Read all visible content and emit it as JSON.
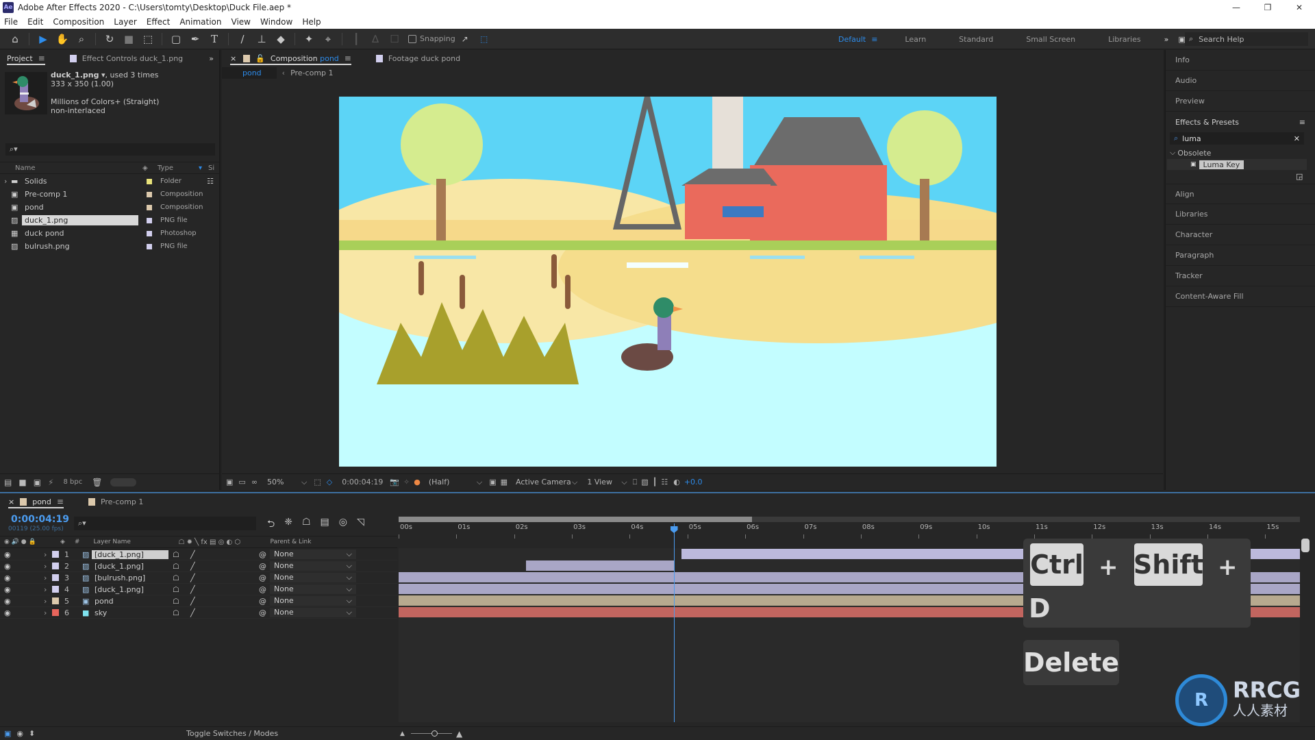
{
  "window": {
    "app_icon": "Ae",
    "title": "Adobe After Effects 2020 - C:\\Users\\tomty\\Desktop\\Duck File.aep *",
    "controls": [
      "minimize",
      "restore",
      "close"
    ]
  },
  "menu": [
    "File",
    "Edit",
    "Composition",
    "Layer",
    "Effect",
    "Animation",
    "View",
    "Window",
    "Help"
  ],
  "toolbar": {
    "tools": [
      "home-icon",
      "selection-tool-icon",
      "hand-tool-icon",
      "zoom-tool-icon",
      "rotate-tool-icon",
      "camera-tool-icon",
      "pan-behind-icon",
      "rectangle-tool-icon",
      "pen-tool-icon",
      "type-tool-icon",
      "brush-tool-icon",
      "clone-stamp-icon",
      "eraser-icon",
      "roto-brush-icon",
      "puppet-pin-icon"
    ],
    "snapping_label": "Snapping",
    "workspaces": [
      "Default",
      "Learn",
      "Standard",
      "Small Screen",
      "Libraries"
    ],
    "active_workspace": "Default",
    "search_help_placeholder": "Search Help"
  },
  "project_panel": {
    "tabs": [
      {
        "label": "Project",
        "active": true
      },
      {
        "label": "Effect Controls duck_1.png",
        "active": false
      }
    ],
    "selected_file": {
      "name": "duck_1.png",
      "used": ", used 3 times",
      "dimensions": "333 x 350 (1.00)",
      "colors": "Millions of Colors+ (Straight)",
      "interlace": "non-interlaced"
    },
    "columns": {
      "name": "Name",
      "type": "Type",
      "size": "Si"
    },
    "items": [
      {
        "name": "Solids",
        "type": "Folder",
        "color": "#e8e27a",
        "icon": "folder-icon",
        "expandable": true
      },
      {
        "name": "Pre-comp 1",
        "type": "Composition",
        "color": "#dcc9ac",
        "icon": "composition-icon"
      },
      {
        "name": "pond",
        "type": "Composition",
        "color": "#dcc9ac",
        "icon": "composition-icon"
      },
      {
        "name": "duck_1.png",
        "type": "PNG file",
        "color": "#d2cfee",
        "icon": "image-file-icon",
        "selected": true
      },
      {
        "name": "duck pond",
        "type": "Photoshop",
        "color": "#d2cfee",
        "icon": "photoshop-file-icon"
      },
      {
        "name": "bulrush.png",
        "type": "PNG file",
        "color": "#d2cfee",
        "icon": "image-file-icon"
      }
    ],
    "bpc_label": "8 bpc"
  },
  "composition_panel": {
    "tabs": [
      {
        "label": "Composition",
        "comp": "pond",
        "active": true
      },
      {
        "label": "Footage duck pond",
        "active": false
      }
    ],
    "breadcrumbs": [
      "pond",
      "Pre-comp 1"
    ],
    "footer": {
      "zoom": "50%",
      "timecode": "0:00:04:19",
      "resolution": "(Half)",
      "camera": "Active Camera",
      "views": "1 View",
      "exposure": "+0.0"
    }
  },
  "right_panels": {
    "items_top": [
      "Info",
      "Audio",
      "Preview"
    ],
    "effects_presets": {
      "title": "Effects & Presets",
      "search_value": "luma",
      "category": "Obsolete",
      "result": "Luma Key"
    },
    "items_bottom": [
      "Align",
      "Libraries",
      "Character",
      "Paragraph",
      "Tracker",
      "Content-Aware Fill"
    ]
  },
  "timeline": {
    "tabs": [
      {
        "label": "pond",
        "active": true
      },
      {
        "label": "Pre-comp 1",
        "active": false
      }
    ],
    "timecode": "0:00:04:19",
    "frame_info": "00119 (25.00 fps)",
    "columns": {
      "layer_name": "Layer Name",
      "parent": "Parent & Link",
      "num": "#"
    },
    "ruler": [
      "00s",
      "01s",
      "02s",
      "03s",
      "04s",
      "05s",
      "06s",
      "07s",
      "08s",
      "09s",
      "10s",
      "11s",
      "12s",
      "13s",
      "14s",
      "15s"
    ],
    "playhead_seconds": 4.76,
    "duration_seconds": 15.6,
    "layers": [
      {
        "num": "1",
        "name": "[duck_1.png]",
        "color": "#d2cfee",
        "icon": "image-file-icon",
        "parent": "None",
        "bar_color": "#a9a6c6",
        "in": 4.9,
        "out": 15.6,
        "selected": true
      },
      {
        "num": "2",
        "name": "[duck_1.png]",
        "color": "#d2cfee",
        "icon": "image-file-icon",
        "parent": "None",
        "bar_color": "#a9a6c6",
        "in": 2.2,
        "out": 4.76
      },
      {
        "num": "3",
        "name": "[bulrush.png]",
        "color": "#d2cfee",
        "icon": "image-file-icon",
        "parent": "None",
        "bar_color": "#a9a6c6",
        "in": 0,
        "out": 15.6
      },
      {
        "num": "4",
        "name": "[duck_1.png]",
        "color": "#d2cfee",
        "icon": "image-file-icon",
        "parent": "None",
        "bar_color": "#a9a6c6",
        "in": 0,
        "out": 15.6
      },
      {
        "num": "5",
        "name": "pond",
        "color": "#dcc9ac",
        "icon": "composition-icon",
        "parent": "None",
        "bar_color": "#b7a98f",
        "in": 0,
        "out": 15.6
      },
      {
        "num": "6",
        "name": "sky",
        "color": "#e8655c",
        "icon": "solid-icon",
        "parent": "None",
        "bar_color": "#c2655f",
        "in": 0,
        "out": 15.6
      }
    ],
    "footer_label": "Toggle Switches / Modes"
  },
  "shortcut_overlay": {
    "keys_line1": [
      "Ctrl",
      "+",
      "Shift",
      "+"
    ],
    "keys_line2": [
      "D"
    ],
    "keys_line3": [
      "Delete"
    ]
  },
  "watermark": {
    "brand": "RRCG",
    "sub": "人人素材"
  }
}
